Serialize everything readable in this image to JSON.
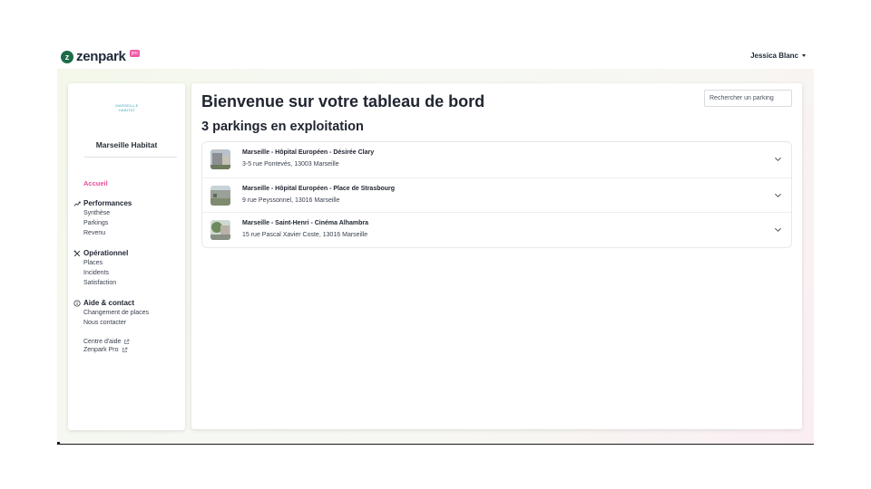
{
  "brand": {
    "name": "zenpark",
    "badge": "pro",
    "pin_letter": "z",
    "badge_color": "#ef5aa4",
    "pin_color": "#1f6b4a"
  },
  "user": {
    "name": "Jessica Blanc"
  },
  "sidebar": {
    "org_logo_line1": "MARSEILLE",
    "org_logo_line2": "HABITAT",
    "org_name": "Marseille Habitat",
    "home": "Accueil",
    "sections": [
      {
        "title": "Performances",
        "icon": "chart-line-icon",
        "items": [
          "Synthèse",
          "Parkings",
          "Revenu"
        ]
      },
      {
        "title": "Opérationnel",
        "icon": "tools-icon",
        "items": [
          "Places",
          "Incidents",
          "Satisfaction"
        ]
      },
      {
        "title": "Aide & contact",
        "icon": "info-icon",
        "items": [
          "Changement de places",
          "Nous contacter"
        ]
      }
    ],
    "external_links": [
      "Centre d'aide",
      "Zenpark Pro"
    ],
    "accent": "#ea4d9a"
  },
  "main": {
    "title": "Bienvenue sur votre tableau de bord",
    "search_placeholder": "Rechercher un parking",
    "subtitle": "3 parkings en exploitation",
    "parkings": [
      {
        "name": "Marseille - Hôpital Européen - Désirée Clary",
        "address": "3-5 rue Pontevès, 13003 Marseille"
      },
      {
        "name": "Marseille - Hôpital Européen - Place de Strasbourg",
        "address": "9 rue Peyssonnel, 13016 Marseille"
      },
      {
        "name": "Marseille - Saint-Henri - Cinéma Alhambra",
        "address": "15 rue Pascal Xavier Coste, 13016 Marseille"
      }
    ]
  }
}
